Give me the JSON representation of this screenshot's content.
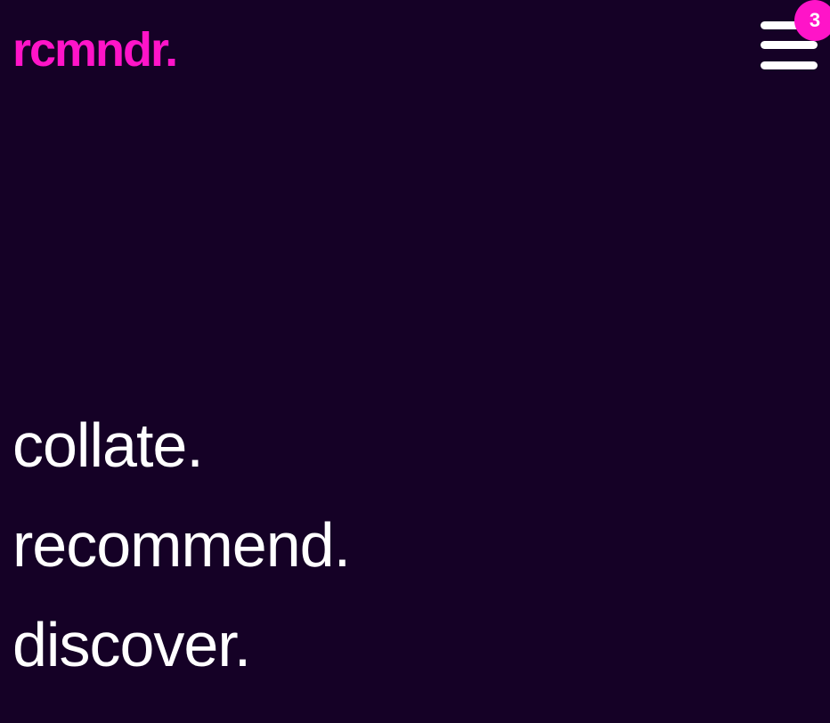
{
  "brand": {
    "logo_text": "rcmndr.",
    "accent_color": "#ff14c8",
    "background_color": "#150126"
  },
  "menu": {
    "icon": "hamburger-menu-icon",
    "badge_count": "3"
  },
  "tagline": [
    "collate.",
    "recommend.",
    "discover."
  ]
}
